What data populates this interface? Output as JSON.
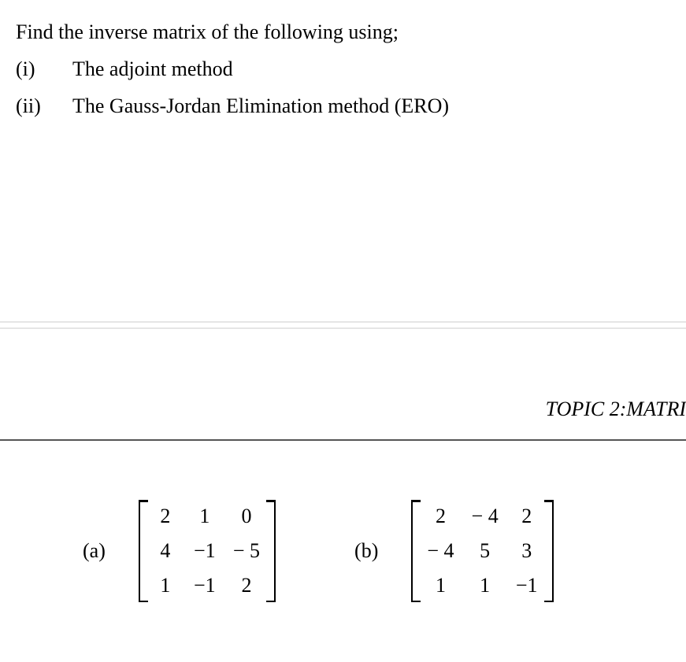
{
  "intro": "Find the inverse matrix of the following  using;",
  "items": [
    {
      "num": "(i)",
      "text": "The adjoint method"
    },
    {
      "num": "(ii)",
      "text": "The Gauss-Jordan Elimination method (ERO)"
    }
  ],
  "topic": "TOPIC 2:MATRI",
  "matrices": {
    "a": {
      "label": "(a)",
      "cells": [
        "2",
        "1",
        "0",
        "4",
        "−1",
        "− 5",
        "1",
        "−1",
        "2"
      ]
    },
    "b": {
      "label": "(b)",
      "cells": [
        "2",
        "− 4",
        "2",
        "− 4",
        "5",
        "3",
        "1",
        "1",
        "−1"
      ]
    }
  }
}
